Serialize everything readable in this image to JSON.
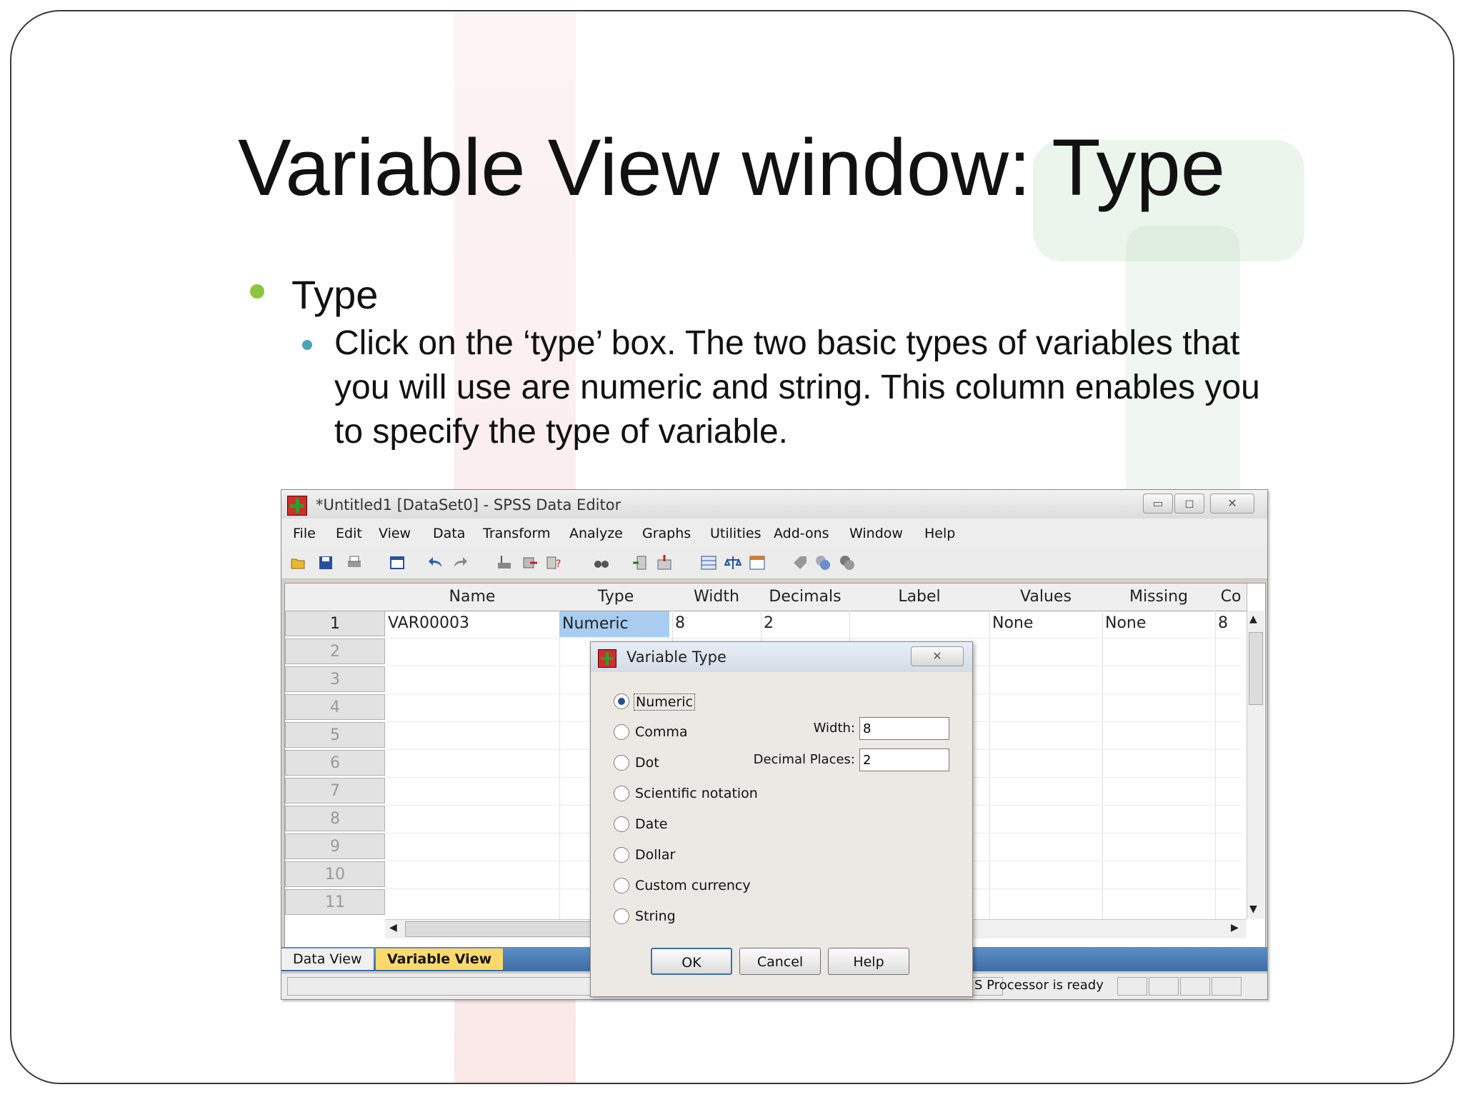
{
  "slide": {
    "title": "Variable View window: Type",
    "bullet": "Type",
    "sub_bullet": "Click on the ‘type’ box. The two basic types of variables that you will use are numeric and string. This column enables you to specify the type of variable."
  },
  "window": {
    "title": "*Untitled1 [DataSet0] - SPSS Data Editor",
    "controls": {
      "minimize": "▭",
      "maximize": "◻",
      "close": "✕"
    },
    "menu": [
      "File",
      "Edit",
      "View",
      "Data",
      "Transform",
      "Analyze",
      "Graphs",
      "Utilities",
      "Add-ons",
      "Window",
      "Help"
    ],
    "toolbar_icons": [
      "open-icon",
      "save-icon",
      "print-icon",
      "dialog-recall-icon",
      "undo-icon",
      "redo-icon",
      "goto-case-icon",
      "goto-variable-icon",
      "variables-icon",
      "find-icon",
      "insert-cases-icon",
      "insert-variable-icon",
      "split-file-icon",
      "weight-cases-icon",
      "select-cases-icon",
      "value-labels-icon",
      "use-sets-icon",
      "show-all-icon"
    ],
    "columns": [
      "Name",
      "Type",
      "Width",
      "Decimals",
      "Label",
      "Values",
      "Missing",
      "Co"
    ],
    "rows": [
      {
        "num": "1",
        "name": "VAR00003",
        "type": "Numeric",
        "width": "8",
        "decimals": "2",
        "label": "",
        "values": "None",
        "missing": "None",
        "co": "8"
      },
      {
        "num": "2"
      },
      {
        "num": "3"
      },
      {
        "num": "4"
      },
      {
        "num": "5"
      },
      {
        "num": "6"
      },
      {
        "num": "7"
      },
      {
        "num": "8"
      },
      {
        "num": "9"
      },
      {
        "num": "10"
      },
      {
        "num": "11"
      }
    ],
    "tabs": {
      "data_view": "Data View",
      "variable_view": "Variable View"
    },
    "status": "S  Processor is ready",
    "accent_color": "#4a7db8",
    "active_tab_color": "#fcd96b"
  },
  "dialog": {
    "title": "Variable Type",
    "close": "✕",
    "options": [
      "Numeric",
      "Comma",
      "Dot",
      "Scientific notation",
      "Date",
      "Dollar",
      "Custom currency",
      "String"
    ],
    "selected": "Numeric",
    "width_label": "Width:",
    "width_value": "8",
    "decimal_label": "Decimal Places:",
    "decimal_value": "2",
    "ok": "OK",
    "cancel": "Cancel",
    "help": "Help"
  }
}
